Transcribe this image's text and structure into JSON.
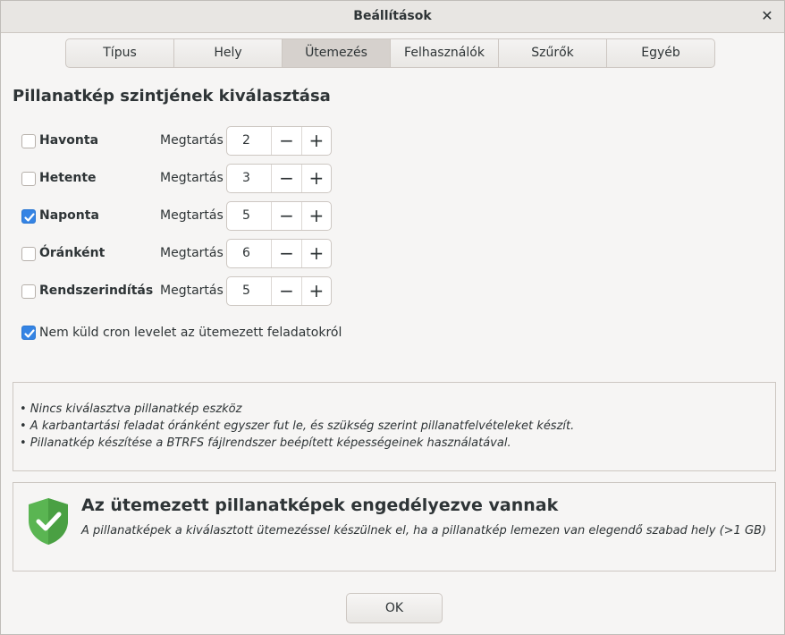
{
  "window": {
    "title": "Beállítások"
  },
  "tabs": [
    {
      "label": "Típus"
    },
    {
      "label": "Hely"
    },
    {
      "label": "Ütemezés"
    },
    {
      "label": "Felhasználók"
    },
    {
      "label": "Szűrők"
    },
    {
      "label": "Egyéb"
    }
  ],
  "active_tab": "Ütemezés",
  "section_title": "Pillanatkép szintjének kiválasztása",
  "keep_label": "Megtartás",
  "levels": [
    {
      "label": "Havonta",
      "checked": false,
      "keep": "2"
    },
    {
      "label": "Hetente",
      "checked": false,
      "keep": "3"
    },
    {
      "label": "Naponta",
      "checked": true,
      "keep": "5"
    },
    {
      "label": "Óránként",
      "checked": false,
      "keep": "6"
    },
    {
      "label": "Rendszerindítás",
      "checked": false,
      "keep": "5"
    }
  ],
  "cron": {
    "label": "Nem küld cron levelet az ütemezett feladatokról",
    "checked": true
  },
  "info": [
    "• Nincs kiválasztva pillanatkép eszköz",
    "• A karbantartási feladat óránként egyszer fut le, és szükség szerint pillanatfelvételeket készít.",
    "• Pillanatkép készítése a BTRFS fájlrendszer beépített képességeinek használatával."
  ],
  "status": {
    "title": "Az ütemezett pillanatképek engedélyezve vannak",
    "subtitle": "A pillanatképek a kiválasztott ütemezéssel készülnek el, ha a pillanatkép lemezen van elegendő szabad hely (>1 GB)",
    "icon": "shield-check-icon",
    "color": "#5ab552"
  },
  "ok_label": "OK",
  "colors": {
    "accent": "#3584e4",
    "active_tab": "#d6d1cd"
  }
}
